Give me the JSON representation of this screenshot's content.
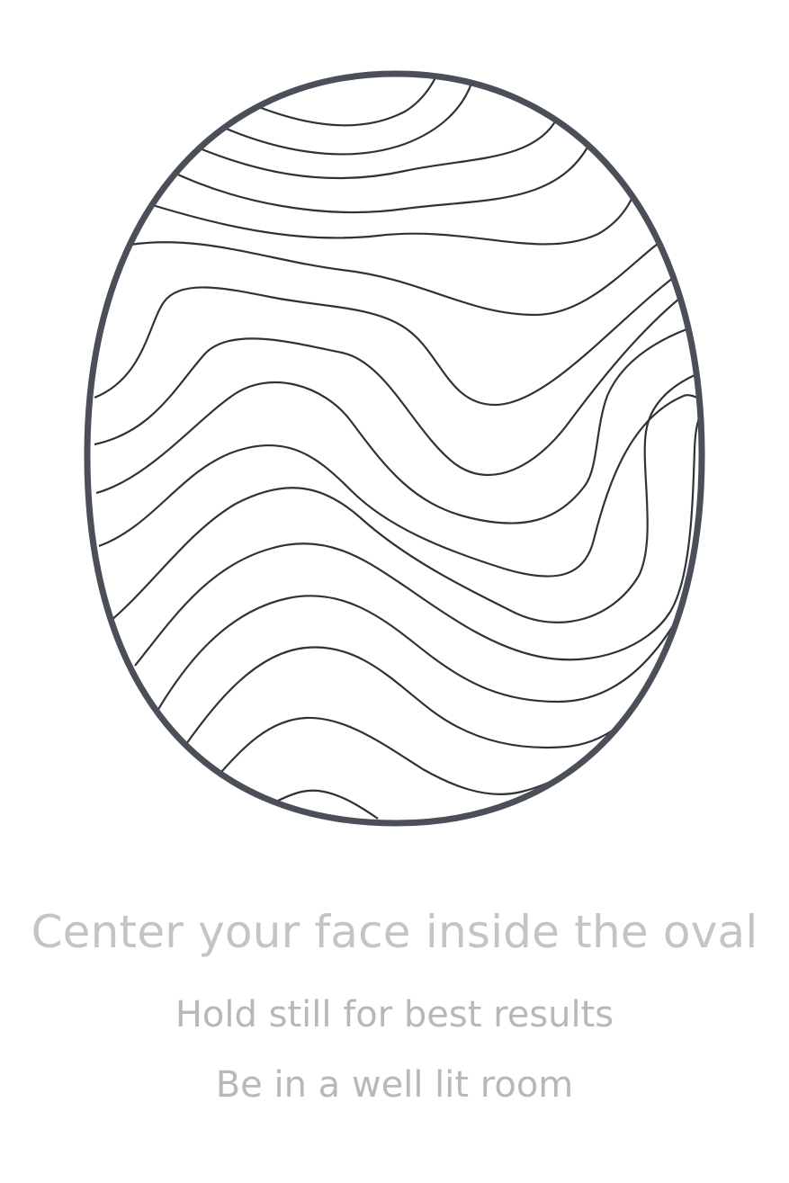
{
  "instructions": {
    "title": "Center your face inside the oval",
    "tips": [
      "Hold still for best results",
      "Be in a well lit room"
    ]
  },
  "colors": {
    "oval_stroke": "#4b4f57",
    "contour_stroke": "#2f3237",
    "title_text": "#c4c4c4",
    "tip_text": "#b8b8b8"
  },
  "icons": {
    "oval": "face-oval-guide-icon",
    "contours": "wavy-contour-lines-icon"
  }
}
